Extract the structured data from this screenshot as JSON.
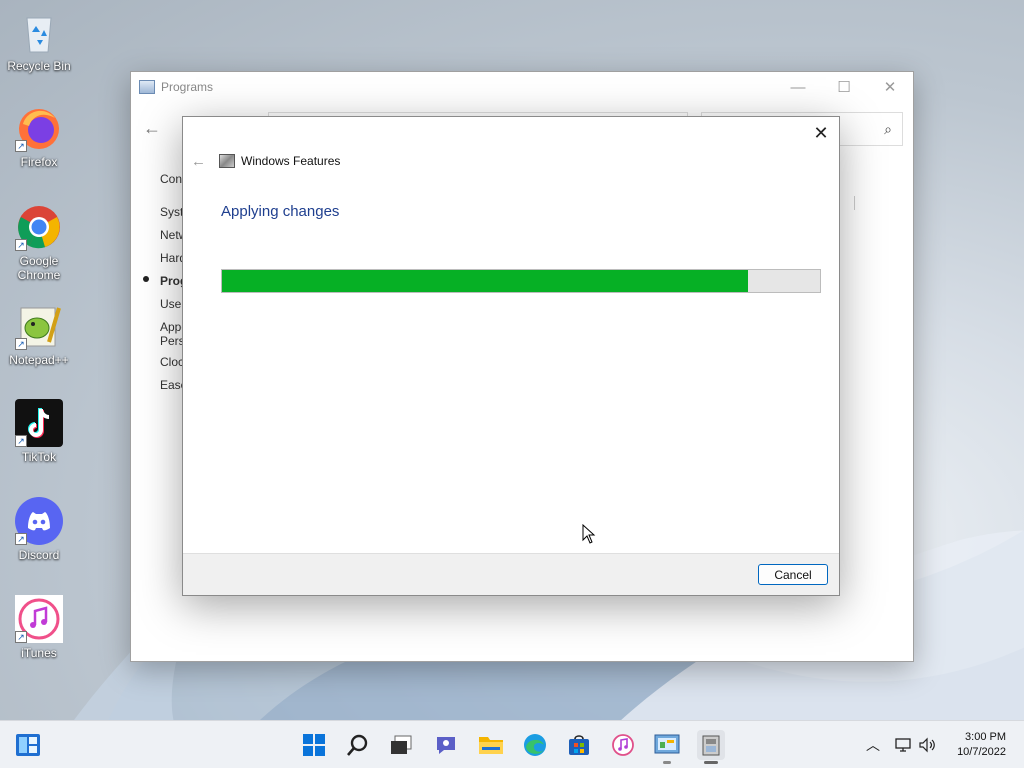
{
  "desktop": {
    "icons": [
      {
        "label": "Recycle Bin",
        "name": "recycle-bin-icon"
      },
      {
        "label": "Firefox",
        "name": "firefox-icon"
      },
      {
        "label": "Google Chrome",
        "name": "chrome-icon"
      },
      {
        "label": "Notepad++",
        "name": "notepad-plus-plus-icon"
      },
      {
        "label": "TikTok",
        "name": "tiktok-icon"
      },
      {
        "label": "Discord",
        "name": "discord-icon"
      },
      {
        "label": "iTunes",
        "name": "itunes-icon"
      }
    ]
  },
  "control_panel": {
    "title": "Programs",
    "sidebar_items": [
      {
        "label": "Cont",
        "selected": false
      },
      {
        "label": "Syste",
        "selected": false
      },
      {
        "label": "Netw",
        "selected": false
      },
      {
        "label": "Hard",
        "selected": false
      },
      {
        "label": "Prog",
        "selected": true
      },
      {
        "label": "User",
        "selected": false
      },
      {
        "label": "Appe\nPerso",
        "selected": false
      },
      {
        "label": "Clock",
        "selected": false
      },
      {
        "label": "Ease",
        "selected": false
      }
    ],
    "link_fragment": "s"
  },
  "dialog": {
    "title": "Windows Features",
    "heading": "Applying changes",
    "progress_fraction": 0.88,
    "cancel_label": "Cancel"
  },
  "taskbar": {
    "apps": [
      "start-icon",
      "search-icon",
      "task-view-icon",
      "teams-chat-icon",
      "file-explorer-icon",
      "edge-icon",
      "store-icon",
      "itunes-icon",
      "control-panel-icon",
      "windows-features-icon"
    ],
    "time": "3:00 PM",
    "date": "10/7/2022"
  },
  "colors": {
    "progress_fill": "#06b025",
    "heading": "#1f3f8f",
    "accent": "#0067c0"
  }
}
